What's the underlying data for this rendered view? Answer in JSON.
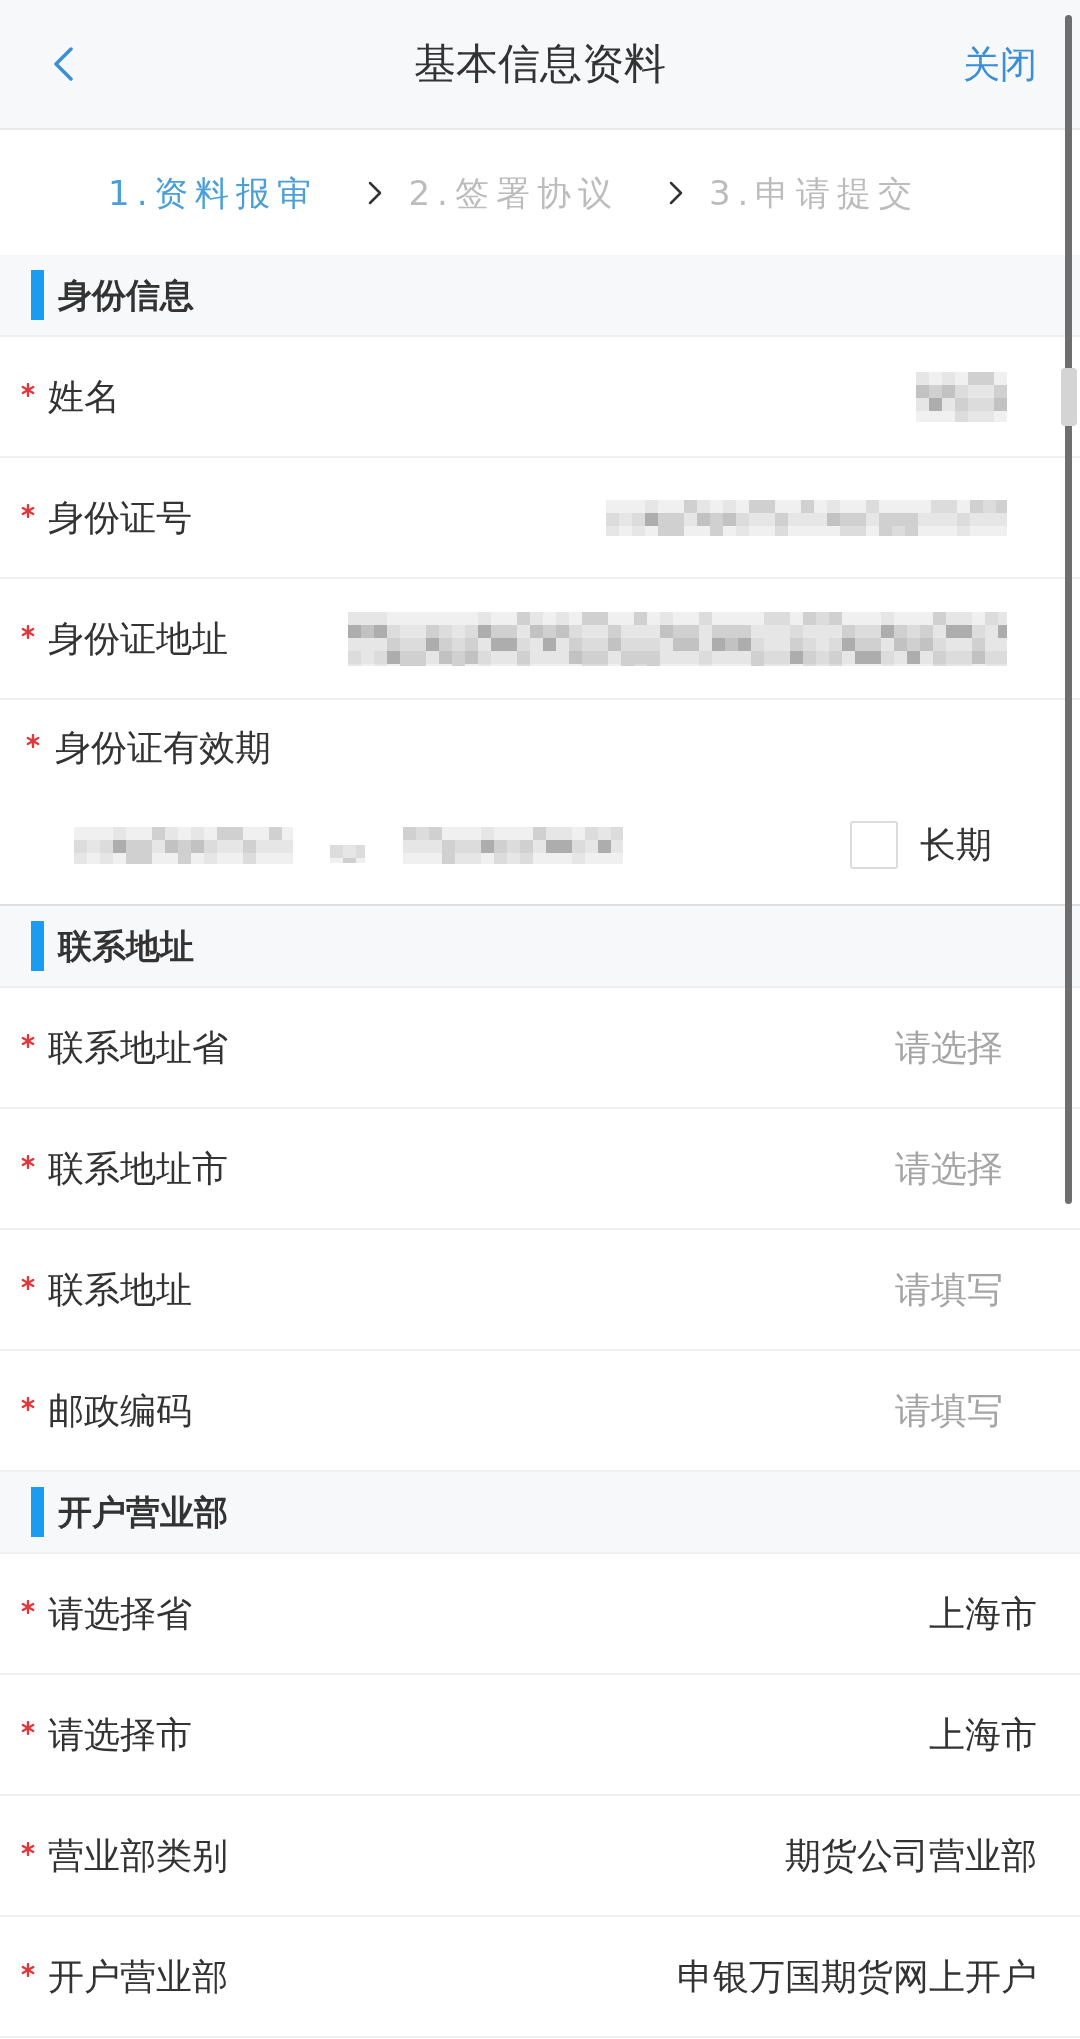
{
  "header": {
    "title": "基本信息资料",
    "close_label": "关闭"
  },
  "steps": [
    {
      "label": "1.资料报审",
      "selected": true
    },
    {
      "label": "2.签署协议",
      "selected": false
    },
    {
      "label": "3.申请提交",
      "selected": false
    }
  ],
  "sections": [
    {
      "title": "身份信息",
      "rows": [
        {
          "label": "姓名",
          "required": true,
          "kind": "redacted_short"
        },
        {
          "label": "身份证号",
          "required": true,
          "kind": "redacted_medium"
        },
        {
          "label": "身份证地址",
          "required": true,
          "kind": "redacted_long"
        },
        {
          "label": "身份证有效期",
          "required": true,
          "kind": "date_range",
          "checkbox": {
            "label": "长期",
            "checked": false
          }
        }
      ]
    },
    {
      "title": "联系地址",
      "rows": [
        {
          "label": "联系地址省",
          "required": true,
          "kind": "select",
          "placeholder": "请选择"
        },
        {
          "label": "联系地址市",
          "required": true,
          "kind": "select",
          "placeholder": "请选择"
        },
        {
          "label": "联系地址",
          "required": true,
          "kind": "input",
          "placeholder": "请填写"
        },
        {
          "label": "邮政编码",
          "required": true,
          "kind": "input",
          "placeholder": "请填写"
        }
      ]
    },
    {
      "title": "开户营业部",
      "rows": [
        {
          "label": "请选择省",
          "required": true,
          "kind": "select",
          "value": "上海市"
        },
        {
          "label": "请选择市",
          "required": true,
          "kind": "select",
          "value": "上海市"
        },
        {
          "label": "营业部类别",
          "required": true,
          "kind": "select",
          "value": "期货公司营业部"
        },
        {
          "label": "开户营业部",
          "required": true,
          "kind": "select",
          "value": "申银万国期货网上开户"
        }
      ]
    }
  ]
}
